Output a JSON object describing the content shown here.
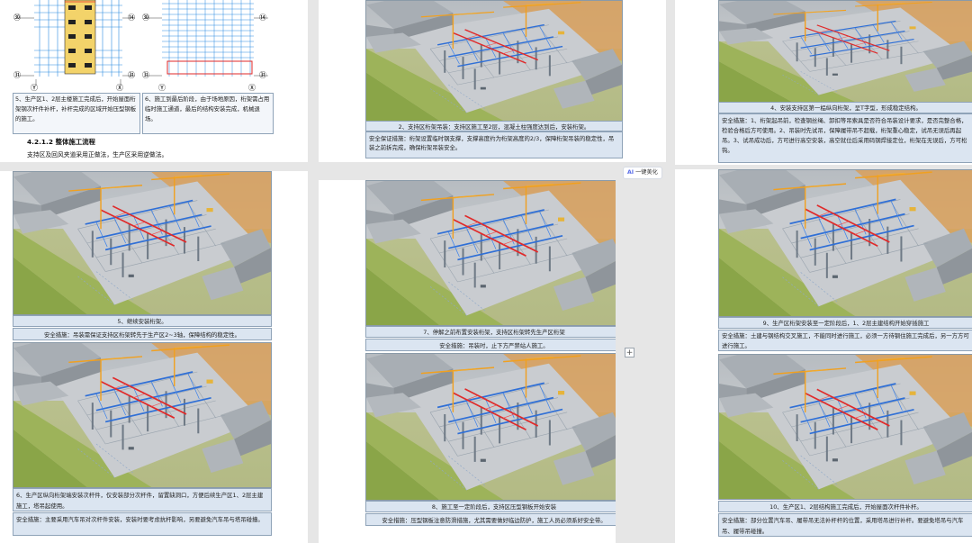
{
  "toolbar": {
    "beautify_ai": "AI",
    "beautify_label": "一键美化",
    "add_label": "+"
  },
  "top_left": {
    "drawing_labels": {
      "a": "㉚",
      "b": "㉛",
      "c": "㉜",
      "d": "⑭",
      "y": "Ⓨ",
      "x": "Ⓧ"
    },
    "caption_5": "5、生产区1、2层主楼施工完成后，开始屋面桁架钢次杆件补杆，补杆完成的区域开始压型钢板的施工。",
    "caption_6": "6、施工到最后阶段，由于场地原因，桁架需占用临时施工通道，最后的结构安装完成，机械退场。",
    "heading": "4.2.1.2 整体施工流程",
    "paragraph": "支持区及回风夹道采用正做法，生产区采用逆做法。"
  },
  "col2": {
    "caption_2_title": "2、支持区桁架吊装：支持区施工至2层，混凝土柱强度达到后，安装桁架。",
    "caption_2_safety": "安全保证措施：桁架设置临时钢支撑，支撑高度约为桁架高度的2/3，保障桁架吊装的稳定性，吊装之前拆完成，确保桁架吊装安全。",
    "caption_7_title": "7、停解之前布置安装桁架，支持区桁架转先生产区桁架",
    "caption_7_safety": "安全措施：吊装时，止下方严禁站人施工。",
    "caption_8_title": "8、施工至一定阶段后，支持区压型钢板开始安装",
    "caption_8_safety": "安全措施：压型钢板注意防滑措施，尤其需要做好临边防护，施工人员必须系好安全带。"
  },
  "col1": {
    "caption_5_title": "5、继续安装桁架。",
    "caption_5_safety": "安全措施：吊装需保证支持区桁架转先于生产区2~3轴，保障结构的稳定性。",
    "caption_6_title": "6、生产区纵向桁架端安装次杆件，仅安装部分次杆件，留置缺洞口，方便后续生产区1、2层主建施工，塔吊起使用。",
    "caption_6_safety": "安全措施：主要采用汽车吊对次杆件安装，安装时要考虑抗杆影响，另要避免汽车吊与塔吊碰撞。"
  },
  "col3": {
    "caption_4_title": "4、安装支持区第一榀纵向桁架，呈T字型，形成稳定结构。",
    "caption_4_safety": "安全措施：1、桁架起吊前，检查钢丝绳、卸扣等吊索具是否符合吊装设计要求，是否完整合格，检验合格后方可使用。2、吊装时先试吊，保障履带吊不超载，桁架重心稳定，试吊无误后再起吊。3、试吊成功后，方可进行高空安装，高空就位后采用码钢焊接定位，桁架在无误后，方可松钩。",
    "caption_9_title": "9、生产区桁架安装至一定阶段后，1、2层主建结构开始穿插施工",
    "caption_9_safety": "安全措施：土建与钢结构交叉施工，不能同时进行施工，必须一方待钢住施工完成后，另一方方可进行施工。",
    "caption_10_title": "10、生产区1、2层结构施工完成后，开始屋面次杆件补杆。",
    "caption_10_safety": "安全措施：部分位置汽车吊、履带吊无法补杆杆的位置，采用塔吊进行补杆。要避免塔吊与汽车吊、履带吊碰撞。"
  },
  "colors": {
    "caption_bg": "#dbe5f1",
    "steel_blue": "#2f6fd6",
    "steel_red": "#e02a2a",
    "crane": "#f0a020"
  }
}
